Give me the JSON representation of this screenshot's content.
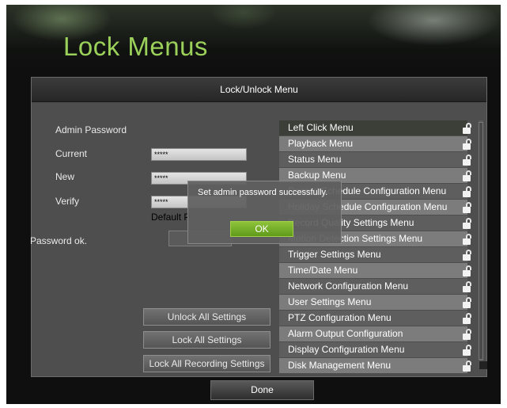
{
  "header": {
    "title": "Lock Menus"
  },
  "panel": {
    "title": "Lock/Unlock Menu"
  },
  "password": {
    "section_label": "Admin Password",
    "current_label": "Current",
    "current_value": "*****",
    "new_label": "New",
    "new_value": "*****",
    "verify_label": "Verify",
    "verify_value": "*****",
    "default_text": "Default P",
    "status_text": "Password ok."
  },
  "actions": {
    "unlock_all": "Unlock All Settings",
    "lock_all": "Lock All Settings",
    "lock_recording": "Lock All Recording Settings"
  },
  "menu_items": [
    {
      "label": "Left Click Menu",
      "icon": "lock-open-icon"
    },
    {
      "label": "Playback Menu",
      "icon": "lock-open-icon"
    },
    {
      "label": "Status Menu",
      "icon": "lock-open-icon"
    },
    {
      "label": "Backup Menu",
      "icon": "lock-open-icon"
    },
    {
      "label": "Record Schedule Configuration Menu",
      "icon": "lock-open-icon"
    },
    {
      "label": "Holiday Schedule Configuration Menu",
      "icon": "lock-open-icon"
    },
    {
      "label": "Record Quality Settings Menu",
      "icon": "lock-open-icon"
    },
    {
      "label": "Motion Detection Settings Menu",
      "icon": "lock-open-icon"
    },
    {
      "label": "Trigger Settings Menu",
      "icon": "lock-open-icon"
    },
    {
      "label": "Time/Date Menu",
      "icon": "lock-open-icon"
    },
    {
      "label": "Network Configuration Menu",
      "icon": "lock-open-icon"
    },
    {
      "label": "User Settings Menu",
      "icon": "lock-open-icon"
    },
    {
      "label": "PTZ Configuration Menu",
      "icon": "lock-open-icon"
    },
    {
      "label": "Alarm Output Configuration",
      "icon": "lock-open-icon"
    },
    {
      "label": "Display Configuration Menu",
      "icon": "lock-open-icon"
    },
    {
      "label": "Disk Management Menu",
      "icon": "lock-open-icon"
    }
  ],
  "dialog": {
    "message": "Set admin password successfully.",
    "ok_label": "OK"
  },
  "footer": {
    "done_label": "Done"
  },
  "colors": {
    "title_green": "#9bd05a",
    "ok_green": "#6fa825"
  }
}
